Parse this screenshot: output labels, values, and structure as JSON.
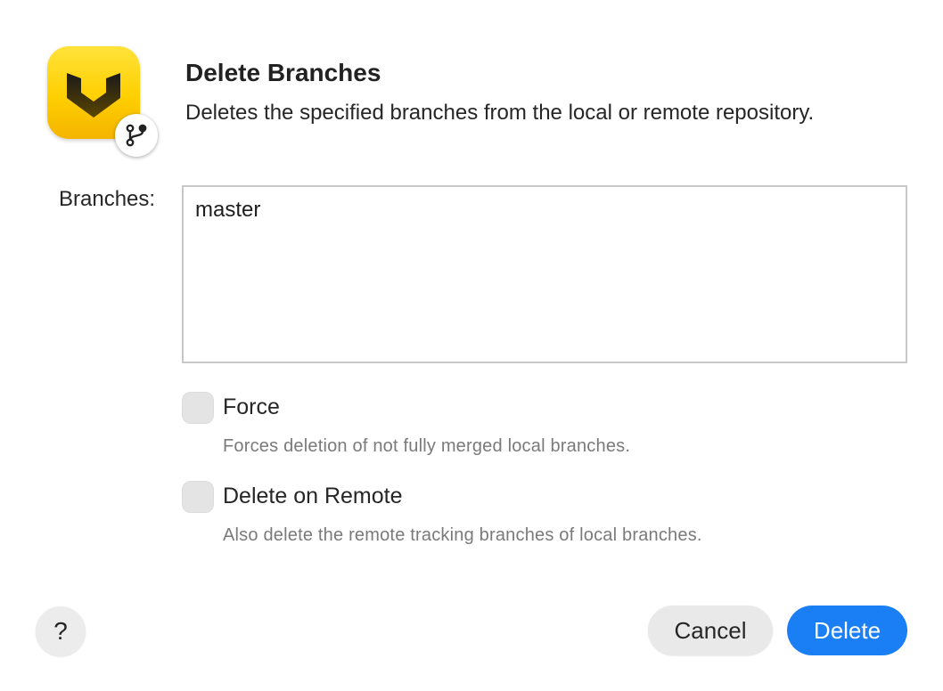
{
  "dialog": {
    "title": "Delete Branches",
    "subtitle": "Deletes the specified branches from the local or remote repository.",
    "app_icon": "yellow-chevron-logo-icon",
    "badge_icon": "git-branch-icon"
  },
  "branches": {
    "label": "Branches:",
    "value": "master"
  },
  "options": [
    {
      "label": "Force",
      "description": "Forces deletion of not fully merged local branches.",
      "checked": false
    },
    {
      "label": "Delete on Remote",
      "description": "Also delete the remote tracking branches of local branches.",
      "checked": false
    }
  ],
  "footer": {
    "help_label": "?",
    "cancel_label": "Cancel",
    "delete_label": "Delete"
  },
  "colors": {
    "accent": "#1a7ff5",
    "icon_yellow": "#ffcf00"
  }
}
